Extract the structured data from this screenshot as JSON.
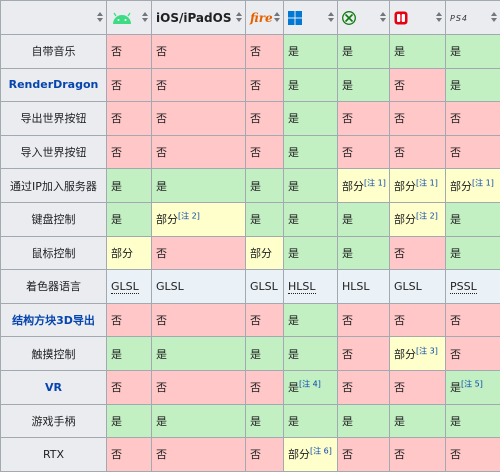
{
  "headers": {
    "android_icon": "android-icon",
    "ios": "iOS/iPadOS",
    "fire": "fire",
    "windows_icon": "windows-icon",
    "xbox_icon": "xbox-icon",
    "switch_icon": "switch-icon",
    "ps4": "PS4"
  },
  "rows": [
    {
      "label": "自带音乐",
      "link": false,
      "cells": [
        [
          "否",
          "no"
        ],
        [
          "否",
          "no"
        ],
        [
          "否",
          "no"
        ],
        [
          "是",
          "yes"
        ],
        [
          "是",
          "yes"
        ],
        [
          "是",
          "yes"
        ],
        [
          "是",
          "yes"
        ]
      ]
    },
    {
      "label": "RenderDragon",
      "link": true,
      "cells": [
        [
          "否",
          "no"
        ],
        [
          "否",
          "no"
        ],
        [
          "否",
          "no"
        ],
        [
          "是",
          "yes"
        ],
        [
          "是",
          "yes"
        ],
        [
          "否",
          "no"
        ],
        [
          "是",
          "yes"
        ]
      ]
    },
    {
      "label": "导出世界按钮",
      "link": false,
      "cells": [
        [
          "否",
          "no"
        ],
        [
          "否",
          "no"
        ],
        [
          "否",
          "no"
        ],
        [
          "是",
          "yes"
        ],
        [
          "否",
          "no"
        ],
        [
          "否",
          "no"
        ],
        [
          "否",
          "no"
        ]
      ]
    },
    {
      "label": "导入世界按钮",
      "link": false,
      "cells": [
        [
          "否",
          "no"
        ],
        [
          "否",
          "no"
        ],
        [
          "否",
          "no"
        ],
        [
          "是",
          "yes"
        ],
        [
          "否",
          "no"
        ],
        [
          "否",
          "no"
        ],
        [
          "否",
          "no"
        ]
      ]
    },
    {
      "label": "通过IP加入服务器",
      "link": false,
      "cells": [
        [
          "是",
          "yes"
        ],
        [
          "是",
          "yes"
        ],
        [
          "是",
          "yes"
        ],
        [
          "是",
          "yes"
        ],
        [
          "部分",
          "partial",
          "[注 1]"
        ],
        [
          "部分",
          "partial",
          "[注 1]"
        ],
        [
          "部分",
          "partial",
          "[注 1]"
        ]
      ]
    },
    {
      "label": "键盘控制",
      "link": false,
      "cells": [
        [
          "是",
          "yes"
        ],
        [
          "部分",
          "partial",
          "[注 2]"
        ],
        [
          "是",
          "yes"
        ],
        [
          "是",
          "yes"
        ],
        [
          "是",
          "yes"
        ],
        [
          "部分",
          "partial",
          "[注 2]"
        ],
        [
          "是",
          "yes"
        ]
      ]
    },
    {
      "label": "鼠标控制",
      "link": false,
      "cells": [
        [
          "部分",
          "partial"
        ],
        [
          "否",
          "no"
        ],
        [
          "部分",
          "partial"
        ],
        [
          "是",
          "yes"
        ],
        [
          "是",
          "yes"
        ],
        [
          "否",
          "no"
        ],
        [
          "是",
          "yes"
        ]
      ]
    },
    {
      "label": "着色器语言",
      "link": false,
      "cells": [
        [
          "GLSL",
          "neutral",
          "",
          "abbr"
        ],
        [
          "GLSL",
          "neutral"
        ],
        [
          "GLSL",
          "neutral"
        ],
        [
          "HLSL",
          "neutral",
          "",
          "abbr"
        ],
        [
          "HLSL",
          "neutral"
        ],
        [
          "GLSL",
          "neutral"
        ],
        [
          "PSSL",
          "neutral",
          "",
          "abbr"
        ]
      ]
    },
    {
      "label": "结构方块3D导出",
      "link": true,
      "cells": [
        [
          "否",
          "no"
        ],
        [
          "否",
          "no"
        ],
        [
          "否",
          "no"
        ],
        [
          "是",
          "yes"
        ],
        [
          "否",
          "no"
        ],
        [
          "否",
          "no"
        ],
        [
          "否",
          "no"
        ]
      ]
    },
    {
      "label": "触摸控制",
      "link": false,
      "cells": [
        [
          "是",
          "yes"
        ],
        [
          "是",
          "yes"
        ],
        [
          "是",
          "yes"
        ],
        [
          "是",
          "yes"
        ],
        [
          "否",
          "no"
        ],
        [
          "部分",
          "partial",
          "[注 3]"
        ],
        [
          "否",
          "no"
        ]
      ]
    },
    {
      "label": "VR",
      "link": true,
      "cells": [
        [
          "否",
          "no"
        ],
        [
          "否",
          "no"
        ],
        [
          "否",
          "no"
        ],
        [
          "是",
          "yes",
          "[注 4]"
        ],
        [
          "否",
          "no"
        ],
        [
          "否",
          "no"
        ],
        [
          "是",
          "yes",
          "[注 5]"
        ]
      ]
    },
    {
      "label": "游戏手柄",
      "link": false,
      "cells": [
        [
          "是",
          "yes"
        ],
        [
          "是",
          "yes"
        ],
        [
          "是",
          "yes"
        ],
        [
          "是",
          "yes"
        ],
        [
          "是",
          "yes"
        ],
        [
          "是",
          "yes"
        ],
        [
          "是",
          "yes"
        ]
      ]
    },
    {
      "label": "RTX",
      "link": false,
      "cells": [
        [
          "否",
          "no"
        ],
        [
          "否",
          "no"
        ],
        [
          "否",
          "no"
        ],
        [
          "部分",
          "partial",
          "[注 6]"
        ],
        [
          "否",
          "no"
        ],
        [
          "否",
          "no"
        ],
        [
          "否",
          "no"
        ]
      ]
    }
  ]
}
